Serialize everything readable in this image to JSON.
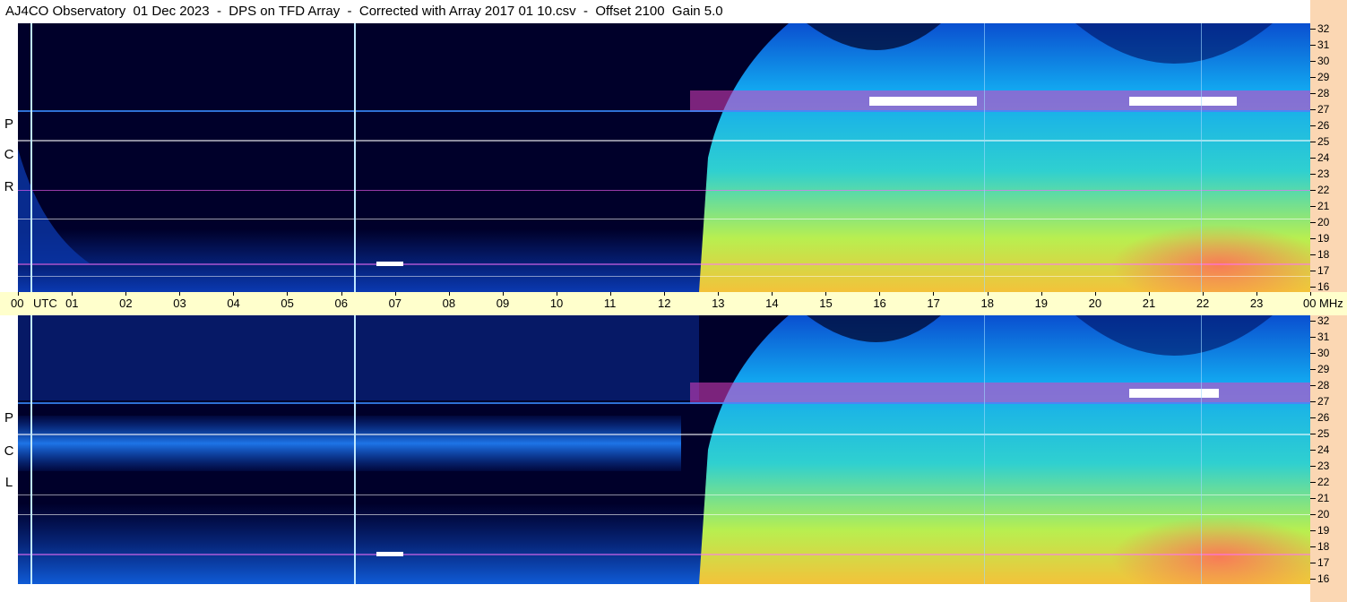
{
  "header": {
    "title": "AJ4CO Observatory  01 Dec 2023  -  DPS on TFD Array  -  Corrected with Array 2017 01 10.csv  -  Offset 2100  Gain 5.0"
  },
  "panels": [
    {
      "polarization_letters": [
        "R",
        "C",
        "P"
      ]
    },
    {
      "polarization_letters": [
        "L",
        "C",
        "P"
      ]
    }
  ],
  "colors": {
    "background": "#00002a",
    "time_axis_band": "#ffffcc",
    "freq_axis_band": "#fbd7b3"
  },
  "chart_data": {
    "type": "heatmap",
    "panels_count": 2,
    "x_axis": {
      "utc_label": "UTC",
      "hour_labels": [
        "00",
        "01",
        "02",
        "03",
        "04",
        "05",
        "06",
        "07",
        "08",
        "09",
        "10",
        "11",
        "12",
        "13",
        "14",
        "15",
        "16",
        "17",
        "18",
        "19",
        "20",
        "21",
        "22",
        "23",
        "00"
      ],
      "end_unit": "MHz",
      "range_hours": [
        0,
        24
      ]
    },
    "y_axis": {
      "labels": [
        "32",
        "31",
        "30",
        "29",
        "28",
        "27",
        "26",
        "25",
        "24",
        "23",
        "22",
        "21",
        "20",
        "19",
        "18",
        "17",
        "16"
      ],
      "range_mhz": [
        16,
        32
      ]
    },
    "intensity_scale": "black-blue-cyan-green-yellow-orange-red-magenta-white"
  }
}
